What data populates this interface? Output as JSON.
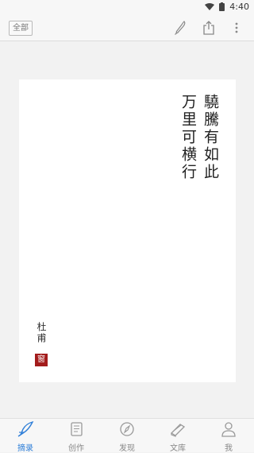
{
  "status": {
    "time": "4:40"
  },
  "toolbar": {
    "filter_label": "全部"
  },
  "card": {
    "poem_lines": [
      "驍騰有如此",
      "万里可横行"
    ],
    "author": "杜甫",
    "seal": "窗"
  },
  "tabs": [
    {
      "label": "摘录",
      "icon": "quill-icon",
      "active": true
    },
    {
      "label": "创作",
      "icon": "notebook-icon",
      "active": false
    },
    {
      "label": "发现",
      "icon": "compass-icon",
      "active": false
    },
    {
      "label": "文库",
      "icon": "books-icon",
      "active": false
    },
    {
      "label": "我",
      "icon": "person-icon",
      "active": false
    }
  ],
  "colors": {
    "accent": "#2f7fd8",
    "seal": "#a31c1c"
  }
}
